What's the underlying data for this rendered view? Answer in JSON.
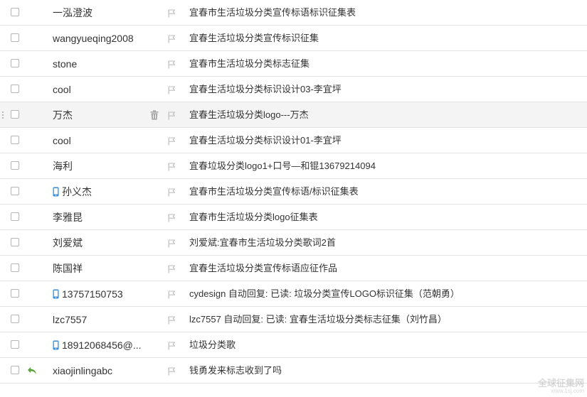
{
  "colors": {
    "flag": "#bdbdbd",
    "reply_arrow": "#5aa23a",
    "phone": "#2f8ee0",
    "row_hover": "#f4f4f4",
    "divider": "#e3e3e3"
  },
  "watermark": {
    "main": "全球征集网",
    "sub": "www.1sj.com"
  },
  "mail_rows": [
    {
      "sender": "一泓澄波",
      "subject": "宜春市生活垃圾分类宣传标语标识征集表",
      "mobile": false,
      "replied": false,
      "hovered": false
    },
    {
      "sender": "wangyueqing2008",
      "subject": "宜春生活垃圾分类宣传标识征集",
      "mobile": false,
      "replied": false,
      "hovered": false
    },
    {
      "sender": "stone",
      "subject": "宜春市生活垃圾分类标志征集",
      "mobile": false,
      "replied": false,
      "hovered": false
    },
    {
      "sender": "cool",
      "subject": "宜春生活垃圾分类标识设计03-李宜坪",
      "mobile": false,
      "replied": false,
      "hovered": false
    },
    {
      "sender": "万杰",
      "subject": "宜春生活垃圾分类logo---万杰",
      "mobile": false,
      "replied": false,
      "hovered": true
    },
    {
      "sender": "cool",
      "subject": "宜春生活垃圾分类标识设计01-李宜坪",
      "mobile": false,
      "replied": false,
      "hovered": false
    },
    {
      "sender": "海利",
      "subject": "宜春垃圾分类logo1+口号—和锟13679214094",
      "mobile": false,
      "replied": false,
      "hovered": false
    },
    {
      "sender": "孙义杰",
      "subject": "宜春市生活垃圾分类宣传标语/标识征集表",
      "mobile": true,
      "replied": false,
      "hovered": false
    },
    {
      "sender": "李雅昆",
      "subject": "宜春市生活垃圾分类logo征集表",
      "mobile": false,
      "replied": false,
      "hovered": false
    },
    {
      "sender": "刘爱斌",
      "subject": "刘爱斌:宜春市生活垃圾分类歌词2首",
      "mobile": false,
      "replied": false,
      "hovered": false
    },
    {
      "sender": "陈国祥",
      "subject": "宜春生活垃圾分类宣传标语应征作品",
      "mobile": false,
      "replied": false,
      "hovered": false
    },
    {
      "sender": "13757150753",
      "subject": "cydesign 自动回复: 已读: 垃圾分类宣传LOGO标识征集（范朝勇）",
      "mobile": true,
      "replied": false,
      "hovered": false
    },
    {
      "sender": "lzc7557",
      "subject": "lzc7557 自动回复: 已读: 宜春生活垃圾分类标志征集（刘竹昌）",
      "mobile": false,
      "replied": false,
      "hovered": false
    },
    {
      "sender": "18912068456@...",
      "subject": "垃圾分类歌",
      "mobile": true,
      "replied": false,
      "hovered": false
    },
    {
      "sender": "xiaojinlingabc",
      "subject": "钱勇发来标志收到了吗",
      "mobile": false,
      "replied": true,
      "hovered": false
    }
  ]
}
